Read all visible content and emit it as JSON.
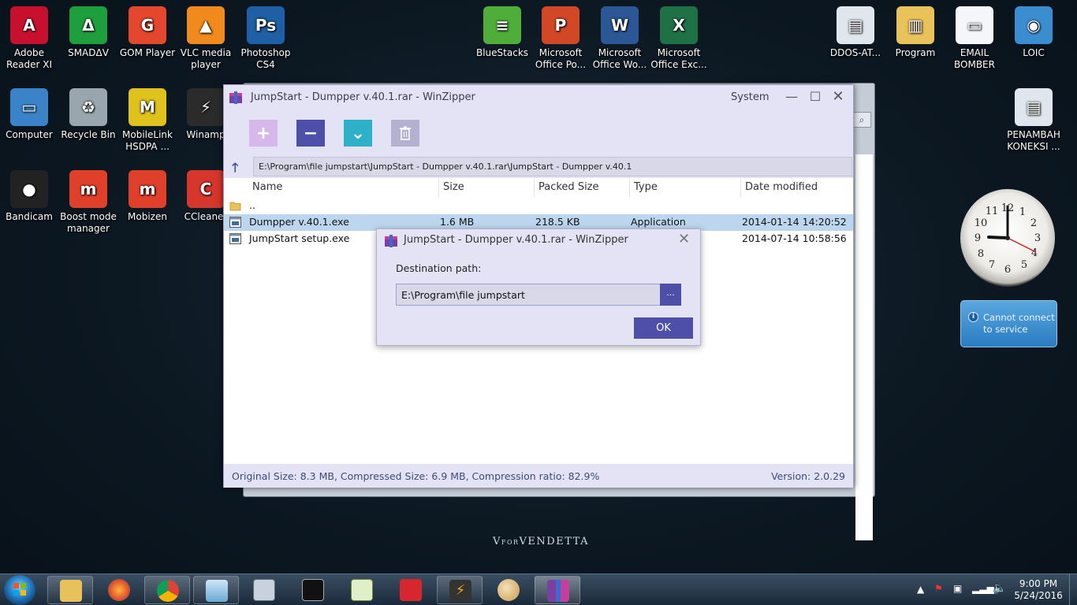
{
  "desktop_icons": [
    {
      "label": "Adobe\nReader XI",
      "icon": "adobe-reader-icon",
      "color": "#c8102e",
      "glyph": "A"
    },
    {
      "label": "SMADΔV",
      "icon": "smadav-icon",
      "color": "#1e9e3c",
      "glyph": "Δ"
    },
    {
      "label": "GOM Player",
      "icon": "gom-player-icon",
      "color": "#e5472e",
      "glyph": "G"
    },
    {
      "label": "VLC media\nplayer",
      "icon": "vlc-icon",
      "color": "#f08a1c",
      "glyph": "▲"
    },
    {
      "label": "Photoshop\nCS4",
      "icon": "photoshop-icon",
      "color": "#1f5fa6",
      "glyph": "Ps"
    },
    {
      "label": "Computer",
      "icon": "computer-icon",
      "color": "#3a83c8",
      "glyph": "▭"
    },
    {
      "label": "Recycle Bin",
      "icon": "recycle-bin-icon",
      "color": "#9aa6ae",
      "glyph": "♻"
    },
    {
      "label": "MobileLink\nHSDPA ...",
      "icon": "mobilelink-icon",
      "color": "#e0c21c",
      "glyph": "M"
    },
    {
      "label": "Winamp",
      "icon": "winamp-icon",
      "color": "#2b2b2b",
      "glyph": "⚡"
    },
    {
      "label": "Bandicam",
      "icon": "bandicam-icon",
      "color": "#222222",
      "glyph": "●"
    },
    {
      "label": "Boost mode\nmanager",
      "icon": "boost-mode-icon",
      "color": "#e0402a",
      "glyph": "m"
    },
    {
      "label": "Mobizen",
      "icon": "mobizen-icon",
      "color": "#e0402a",
      "glyph": "m"
    },
    {
      "label": "CCleaner",
      "icon": "ccleaner-icon",
      "color": "#d6362b",
      "glyph": "C"
    },
    {
      "label": "BlueStacks",
      "icon": "bluestacks-icon",
      "color": "#4fae3a",
      "glyph": "≡"
    },
    {
      "label": "Microsoft\nOffice Po...",
      "icon": "powerpoint-icon",
      "color": "#d24726",
      "glyph": "P"
    },
    {
      "label": "Microsoft\nOffice Wo...",
      "icon": "word-icon",
      "color": "#2b5797",
      "glyph": "W"
    },
    {
      "label": "Microsoft\nOffice Exc...",
      "icon": "excel-icon",
      "color": "#1e7145",
      "glyph": "X"
    },
    {
      "label": "DDOS-AT...",
      "icon": "ddos-window-icon",
      "color": "#dfe6ee",
      "glyph": "▤"
    },
    {
      "label": "Program",
      "icon": "folder-icon",
      "color": "#e9c25a",
      "glyph": "▥"
    },
    {
      "label": "EMAIL\nBOMBER",
      "icon": "email-bomber-icon",
      "color": "#f4f6fa",
      "glyph": "▭"
    },
    {
      "label": "LOIC",
      "icon": "loic-icon",
      "color": "#3a8ecf",
      "glyph": "◉"
    },
    {
      "label": "PENAMBAH\nKONEKSI ...",
      "icon": "penambah-koneksi-icon",
      "color": "#dfe6ee",
      "glyph": "▤"
    }
  ],
  "window": {
    "title": "JumpStart - Dumpper v.40.1.rar - WinZipper",
    "system_menu": "System",
    "address": "E:\\Program\\file jumpstart\\JumpStart - Dumpper v.40.1.rar\\JumpStart - Dumpper v.40.1",
    "columns": [
      "Name",
      "Size",
      "Packed Size",
      "Type",
      "Date modified"
    ],
    "rows": [
      {
        "name": "..",
        "size": "",
        "packed": "",
        "type": "",
        "date": ""
      },
      {
        "name": "Dumpper v.40.1.exe",
        "size": "1.6 MB",
        "packed": "218.5 KB",
        "type": "Application",
        "date": "2014-01-14 14:20:52"
      },
      {
        "name": "JumpStart setup.exe",
        "size": "",
        "packed": "",
        "type": "",
        "date": "2014-07-14 10:58:56"
      }
    ],
    "status_left": "Original Size: 8.3 MB, Compressed Size: 6.9 MB, Compression ratio: 82.9%",
    "status_right": "Version: 2.0.29",
    "toolbar": {
      "add_icon": "+",
      "remove_icon": "−",
      "extract_icon": "⌄",
      "delete_icon": "🗑"
    }
  },
  "dialog": {
    "title": "JumpStart - Dumpper v.40.1.rar - WinZipper",
    "label": "Destination path:",
    "path": "E:\\Program\\file jumpstart",
    "browse": "...",
    "ok": "OK"
  },
  "weather_gadget": {
    "text": "Cannot connect to service"
  },
  "wallpaper_logo": {
    "v": "V",
    "for": "FOR",
    "vendetta": "VENDETTA"
  },
  "taskbar": {
    "time": "9:00 PM",
    "date": "5/24/2016"
  },
  "colors": {
    "accent": "#4d4fa8",
    "window_bg": "#e4e3f5",
    "selection": "#bcd6ef"
  }
}
